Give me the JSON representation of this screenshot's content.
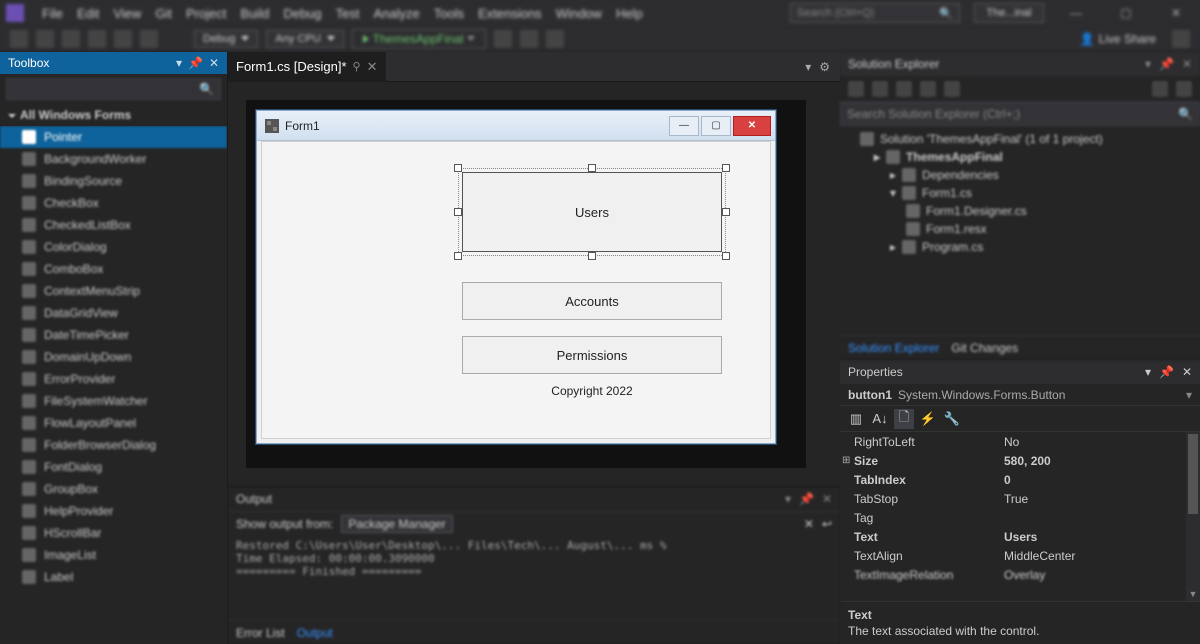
{
  "menubar": {
    "items": [
      "File",
      "Edit",
      "View",
      "Git",
      "Project",
      "Build",
      "Debug",
      "Test",
      "Analyze",
      "Tools",
      "Extensions",
      "Window",
      "Help"
    ],
    "search_placeholder": "Search (Ctrl+Q)",
    "project_badge": "The...inal"
  },
  "toolbar": {
    "config": "Debug",
    "platform": "Any CPU",
    "start_label": "ThemesAppFinal",
    "liveshare": "Live Share"
  },
  "tabs": {
    "active": "Form1.cs [Design]*"
  },
  "toolbox": {
    "title": "Toolbox",
    "section": "All Windows Forms",
    "items": [
      "Pointer",
      "BackgroundWorker",
      "BindingSource",
      "CheckBox",
      "CheckedListBox",
      "ColorDialog",
      "ComboBox",
      "ContextMenuStrip",
      "DataGridView",
      "DateTimePicker",
      "DomainUpDown",
      "ErrorProvider",
      "FileSystemWatcher",
      "FlowLayoutPanel",
      "FolderBrowserDialog",
      "FontDialog",
      "GroupBox",
      "HelpProvider",
      "HScrollBar",
      "ImageList",
      "Label"
    ]
  },
  "form": {
    "title": "Form1",
    "buttons": {
      "users": "Users",
      "accounts": "Accounts",
      "permissions": "Permissions"
    },
    "copyright": "Copyright 2022"
  },
  "output": {
    "title": "Output",
    "show_from_label": "Show output from:",
    "source": "Package Manager",
    "error_list": "Error List",
    "output_tab": "Output"
  },
  "solexp": {
    "title": "Solution Explorer",
    "search_placeholder": "Search Solution Explorer (Ctrl+;)",
    "nodes": {
      "solution": "Solution 'ThemesAppFinal' (1 of 1 project)",
      "project": "ThemesAppFinal",
      "deps": "Dependencies",
      "form": "Form1.cs",
      "designer": "Form1.Designer.cs",
      "resx": "Form1.resx",
      "program": "Program.cs"
    },
    "tabs": {
      "sol": "Solution Explorer",
      "git": "Git Changes"
    }
  },
  "properties": {
    "title": "Properties",
    "object_name": "button1",
    "object_type": "System.Windows.Forms.Button",
    "rows": [
      {
        "name": "RightToLeft",
        "value": "No",
        "bold": false
      },
      {
        "name": "Size",
        "value": "580, 200",
        "bold": true,
        "expandable": true
      },
      {
        "name": "TabIndex",
        "value": "0",
        "bold": true
      },
      {
        "name": "TabStop",
        "value": "True",
        "bold": false
      },
      {
        "name": "Tag",
        "value": "",
        "bold": false
      },
      {
        "name": "Text",
        "value": "Users",
        "bold": true
      },
      {
        "name": "TextAlign",
        "value": "MiddleCenter",
        "bold": false
      },
      {
        "name": "TextImageRelation",
        "value": "Overlay",
        "bold": false,
        "blur": true
      }
    ],
    "desc_name": "Text",
    "desc_text": "The text associated with the control."
  }
}
